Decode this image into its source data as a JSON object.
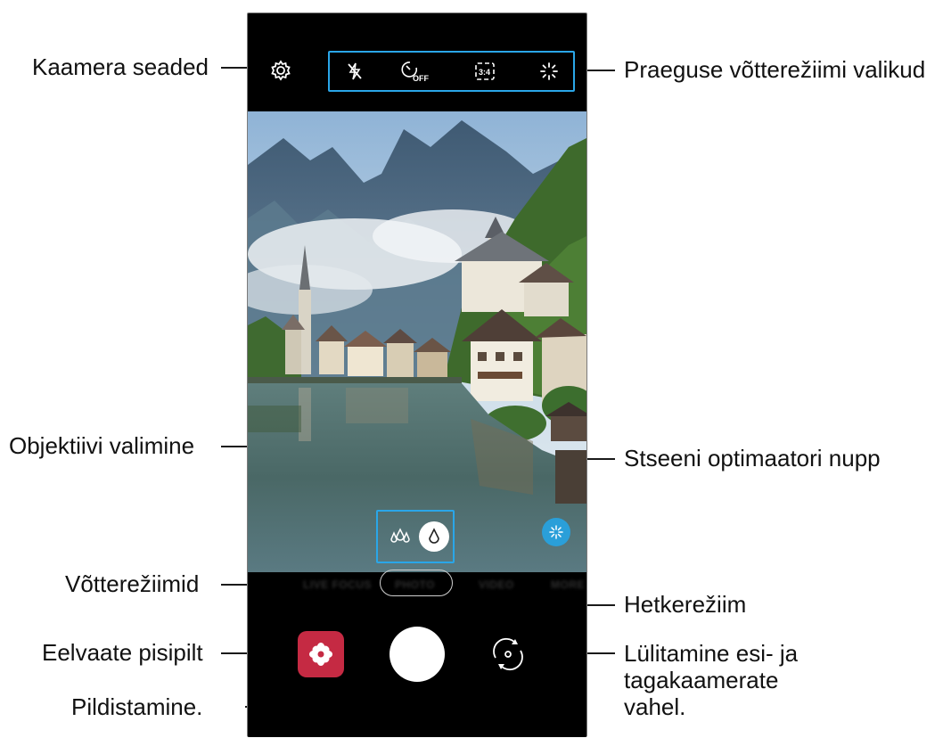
{
  "callouts": {
    "camera_settings": "Kaamera seaded",
    "current_mode_options": "Praeguse võtterežiimi valikud",
    "lens_selection": "Objektiivi valimine",
    "scene_optimizer": "Stseeni optimaatori nupp",
    "shooting_modes": "Võtterežiimid",
    "current_mode": "Hetkerežiim",
    "preview_thumbnail": "Eelvaate pisipilt",
    "switch_cameras_line1": "Lülitamine esi- ja",
    "switch_cameras_line2": "tagakaamerate",
    "switch_cameras_line3": "vahel.",
    "take_picture": "Pildistamine."
  },
  "quick_settings": {
    "timer_text": "OFF",
    "ratio_text": "3:4"
  },
  "mode_bar": {
    "modes": [
      "LIVE FOCUS",
      "PHOTO",
      "VIDEO",
      "MORE"
    ],
    "selected": "PHOTO"
  },
  "icons": [
    "settings-gear-icon",
    "flash-off-icon",
    "timer-off-icon",
    "ratio-icon",
    "filter-sparkle-icon",
    "wide-lens-icon",
    "normal-lens-icon",
    "scene-optimizer-icon",
    "gallery-flower-icon",
    "switch-camera-icon"
  ],
  "colors": {
    "highlight": "#2aa6e8",
    "scene_optimizer": "#2a9fd9",
    "gallery_thumb": "#c52a43",
    "callout_line": "#1a1a1a"
  }
}
